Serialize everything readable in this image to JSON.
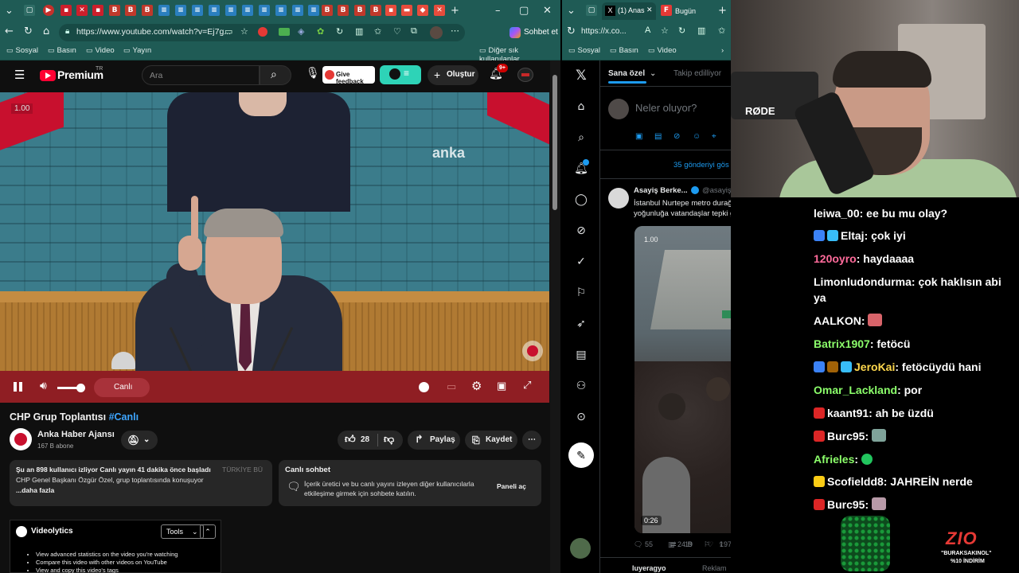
{
  "left_browser": {
    "url": "https://www.youtube.com/watch?v=Ej7g...",
    "sohbet_label": "Sohbet et",
    "bookmarks": [
      "Sosyal",
      "Basın",
      "Video",
      "Yayın"
    ],
    "other_favorites": "Diğer sık kullanılanlar"
  },
  "youtube": {
    "logo_text": "Premium",
    "logo_sup": "TR",
    "search_placeholder": "Ara",
    "feedback_label": "Give feedback",
    "create_label": "Oluştur",
    "notif_count": "9+",
    "speed_label": "1.00",
    "watermark": "anka",
    "live_label": "Canlı",
    "title": "CHP Grup Toplantısı",
    "title_hashtag": "#Canlı",
    "channel": {
      "name": "Anka Haber Ajansı",
      "subs": "167 B abone"
    },
    "likes": "28",
    "share_label": "Paylaş",
    "save_label": "Kaydet",
    "description": {
      "line1": "Şu an 898 kullanıcı izliyor  Canlı yayın 41 dakika önce başladı",
      "line1_tag": "TÜRKİYE BÜ",
      "line2": "CHP Genel Başkanı Özgür Özel, grup toplantısında konuşuyor",
      "more": "...daha fazla"
    },
    "live_chat": {
      "title": "Canlı sohbet",
      "body": "İçerik üretici ve bu canlı yayını izleyen diğer kullanıcılarla etkileşime girmek için sohbete katılın.",
      "button": "Paneli aç"
    },
    "videolytics": {
      "title": "Videolytics",
      "tools": "Tools",
      "items": [
        "View advanced statistics on the video you're watching",
        "Compare this video with other videos on YouTube",
        "View and copy this video's tags"
      ]
    }
  },
  "right_browser": {
    "tabs": [
      "(1) Anas",
      "Bugün"
    ],
    "url": "https://x.co...",
    "bookmarks": [
      "Sosyal",
      "Basın",
      "Video"
    ],
    "x": {
      "tab_for_you": "Sana özel",
      "tab_following": "Takip edilliyor",
      "compose_placeholder": "Neler oluyor?",
      "show_posts": "35 gönderiyi gös",
      "tweet": {
        "author": "Asayiş Berke...",
        "handle": "@asayiş",
        "text": "İstanbul Nurtepe metro durağında yaşanan yoğunluğa vatandaşlar tepki gösterdi.",
        "speed": "1.00",
        "duration": "0:26",
        "replies": "55",
        "retweets": "19",
        "likes": "197",
        "views": "24 B"
      },
      "next_author": "Iuyeragyo",
      "next_label": "Reklam"
    }
  },
  "stream": {
    "mic_label": "RØDE",
    "chat": [
      {
        "user": "leiwa_00",
        "msg": "ee bu mu olay?",
        "color": "#ffffff"
      },
      {
        "user": "Eltaj",
        "msg": "çok iyi",
        "color": "#ffffff"
      },
      {
        "user": "120oyro",
        "msg": "haydaaaa",
        "color": "#ff6b9b"
      },
      {
        "user": "Limonludondurma",
        "msg": "çok haklısın abi ya",
        "color": "#ffffff"
      },
      {
        "user": "AALKON",
        "msg": "",
        "color": "#ffffff"
      },
      {
        "user": "Batrix1907",
        "msg": "fetöcü",
        "color": "#8cff6b"
      },
      {
        "user": "JeroKai",
        "msg": "fetöcüydü hani",
        "color": "#ffd84d"
      },
      {
        "user": "Omar_Lackland",
        "msg": "por",
        "color": "#8cff6b"
      },
      {
        "user": "kaant91",
        "msg": "ah be üzdü",
        "color": "#ffffff"
      },
      {
        "user": "Burc95",
        "msg": "",
        "color": "#ffffff"
      },
      {
        "user": "Afrieles",
        "msg": "",
        "color": "#8cff6b"
      },
      {
        "user": "Scofieldd8",
        "msg": "JAHREİN nerde",
        "color": "#ffffff"
      },
      {
        "user": "Burc95",
        "msg": "",
        "color": "#ffffff"
      }
    ],
    "promo": {
      "brand": "ZIO",
      "code": "\"BURAKSAKINOL\"",
      "discount": "%10 İNDİRİM"
    }
  },
  "colors": {
    "yt_red": "#ff0033",
    "edge_teal": "#1f5b55",
    "x_blue": "#1d9bf0"
  }
}
